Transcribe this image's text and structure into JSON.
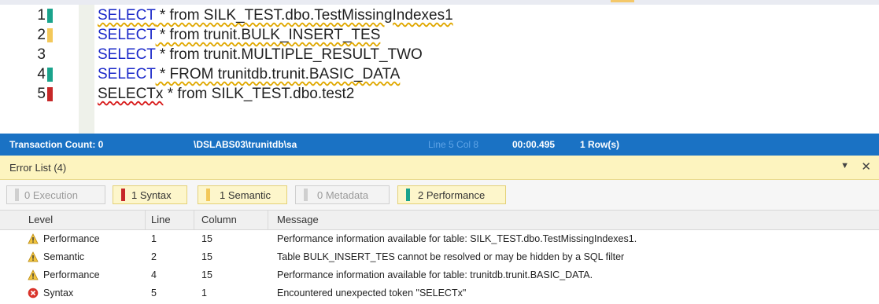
{
  "editor": {
    "lines": [
      {
        "num": "1",
        "marker": "teal",
        "kw": "SELECT",
        "rest": " * from SILK_TEST.dbo.TestMissingIndexes1",
        "squiggle": "yellow"
      },
      {
        "num": "2",
        "marker": "yellow",
        "kw": "SELECT",
        "rest": " * from trunit.BULK_INSERT_TES",
        "squiggle": "yellow"
      },
      {
        "num": "3",
        "marker": "none",
        "kw": "SELECT",
        "rest": " * from trunit.MULTIPLE_RESULT_TWO",
        "squiggle": "none"
      },
      {
        "num": "4",
        "marker": "teal",
        "kw": "SELECT",
        "rest": " * FROM trunitdb.trunit.BASIC_DATA",
        "squiggle": "yellow"
      },
      {
        "num": "5",
        "marker": "red",
        "kw": "SELECTx",
        "rest": " * from SILK_TEST.dbo.test2",
        "squiggle": "red"
      }
    ]
  },
  "status_bar": {
    "transaction_count": "Transaction Count: 0",
    "connection": "\\DSLABS03\\trunitdb\\sa",
    "position": "Line 5 Col 8",
    "elapsed": "00:00.495",
    "rows": "1 Row(s)"
  },
  "error_list": {
    "title": "Error List (4)",
    "dropdown_glyph": "▼",
    "close_glyph": "✕",
    "filters": [
      {
        "label": "0 Execution",
        "active": false,
        "color": ""
      },
      {
        "label": "1 Syntax",
        "active": true,
        "color": "#c62828"
      },
      {
        "label": "1 Semantic",
        "active": true,
        "color": "#f3c85a"
      },
      {
        "label": "0 Metadata",
        "active": false,
        "color": ""
      },
      {
        "label": "2 Performance",
        "active": true,
        "color": "#1aa38c"
      }
    ],
    "columns": [
      "Level",
      "Line",
      "Column",
      "Message"
    ],
    "rows": [
      {
        "level": "Performance",
        "icon": "warning-icon",
        "line": "1",
        "column": "15",
        "message": "Performance information available for table: SILK_TEST.dbo.TestMissingIndexes1."
      },
      {
        "level": "Semantic",
        "icon": "warning-icon",
        "line": "2",
        "column": "15",
        "message": "Table BULK_INSERT_TES cannot be resolved or may be hidden by a SQL filter"
      },
      {
        "level": "Performance",
        "icon": "warning-icon",
        "line": "4",
        "column": "15",
        "message": "Performance information available for table: trunitdb.trunit.BASIC_DATA."
      },
      {
        "level": "Syntax",
        "icon": "error-icon",
        "line": "5",
        "column": "1",
        "message": "Encountered unexpected token \"SELECTx\""
      }
    ]
  },
  "colors": {
    "status_bar_bg": "#1a72c4",
    "error_header_bg": "#fdf4bf",
    "keyword": "#1a28c9",
    "marker_teal": "#1aa38c",
    "marker_yellow": "#f3c85a",
    "marker_red": "#c62828"
  }
}
